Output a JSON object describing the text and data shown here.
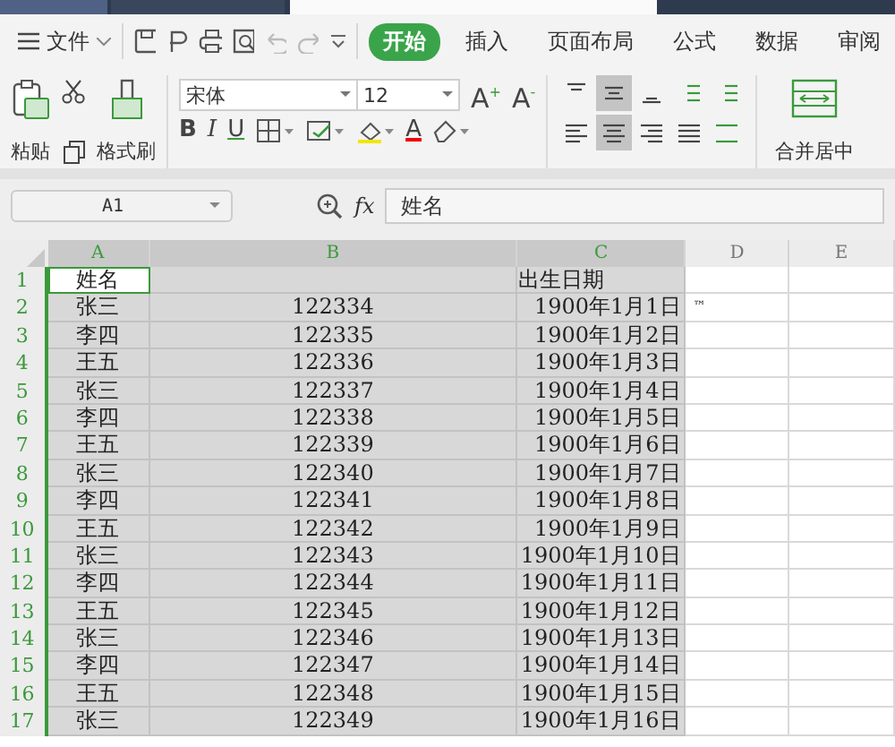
{
  "menu": {
    "file_label": "文件",
    "tabs": [
      {
        "label": "开始",
        "selected": true
      },
      {
        "label": "插入",
        "selected": false
      },
      {
        "label": "页面布局",
        "selected": false
      },
      {
        "label": "公式",
        "selected": false
      },
      {
        "label": "数据",
        "selected": false
      },
      {
        "label": "审阅",
        "selected": false
      }
    ]
  },
  "ribbon": {
    "paste_label": "粘贴",
    "painter_label": "格式刷",
    "font": "宋体",
    "size": "12",
    "grow_label": "A",
    "grow_mark": "+",
    "shrink_label": "A",
    "shrink_mark": "-",
    "style_buttons": [
      {
        "kind": "bold",
        "label": "B"
      },
      {
        "kind": "italic",
        "label": "I"
      },
      {
        "kind": "underline",
        "label": "U"
      }
    ],
    "font_color_label": "A",
    "align_top": [
      {
        "kind": "top",
        "selected": false
      },
      {
        "kind": "middle",
        "selected": true
      },
      {
        "kind": "bottom",
        "selected": false
      },
      {
        "kind": "outdent",
        "selected": false
      },
      {
        "kind": "indent",
        "selected": false
      }
    ],
    "align_bottom": [
      {
        "kind": "left",
        "selected": false
      },
      {
        "kind": "center",
        "selected": true
      },
      {
        "kind": "right",
        "selected": false
      },
      {
        "kind": "justify",
        "selected": false
      },
      {
        "kind": "distribute",
        "selected": false
      }
    ],
    "merge_label": "合并居中"
  },
  "formula_bar": {
    "name_box": "A1",
    "fx": "fx",
    "value": "姓名"
  },
  "columns": [
    {
      "label": "A",
      "selected": true
    },
    {
      "label": "B",
      "selected": true
    },
    {
      "label": "C",
      "selected": true
    },
    {
      "label": "D",
      "selected": false
    },
    {
      "label": "E",
      "selected": false
    }
  ],
  "rows": [
    {
      "num": "1",
      "name": "姓名",
      "date": "出生日期",
      "header": true,
      "active": true
    },
    {
      "num": "2",
      "name": "张三",
      "id": "122334",
      "date": "1900年1月1日",
      "d": "™",
      "header": false,
      "active": false
    },
    {
      "num": "3",
      "name": "李四",
      "id": "122335",
      "date": "1900年1月2日",
      "header": false,
      "active": false
    },
    {
      "num": "4",
      "name": "王五",
      "id": "122336",
      "date": "1900年1月3日",
      "header": false,
      "active": false
    },
    {
      "num": "5",
      "name": "张三",
      "id": "122337",
      "date": "1900年1月4日",
      "header": false,
      "active": false
    },
    {
      "num": "6",
      "name": "李四",
      "id": "122338",
      "date": "1900年1月5日",
      "header": false,
      "active": false
    },
    {
      "num": "7",
      "name": "王五",
      "id": "122339",
      "date": "1900年1月6日",
      "header": false,
      "active": false
    },
    {
      "num": "8",
      "name": "张三",
      "id": "122340",
      "date": "1900年1月7日",
      "header": false,
      "active": false
    },
    {
      "num": "9",
      "name": "李四",
      "id": "122341",
      "date": "1900年1月8日",
      "header": false,
      "active": false
    },
    {
      "num": "10",
      "name": "王五",
      "id": "122342",
      "date": "1900年1月9日",
      "header": false,
      "active": false
    },
    {
      "num": "11",
      "name": "张三",
      "id": "122343",
      "date": "1900年1月10日",
      "header": false,
      "active": false
    },
    {
      "num": "12",
      "name": "李四",
      "id": "122344",
      "date": "1900年1月11日",
      "header": false,
      "active": false
    },
    {
      "num": "13",
      "name": "王五",
      "id": "122345",
      "date": "1900年1月12日",
      "header": false,
      "active": false
    },
    {
      "num": "14",
      "name": "张三",
      "id": "122346",
      "date": "1900年1月13日",
      "header": false,
      "active": false
    },
    {
      "num": "15",
      "name": "李四",
      "id": "122347",
      "date": "1900年1月14日",
      "header": false,
      "active": false
    },
    {
      "num": "16",
      "name": "王五",
      "id": "122348",
      "date": "1900年1月15日",
      "header": false,
      "active": false
    },
    {
      "num": "17",
      "name": "张三",
      "id": "122349",
      "date": "1900年1月16日",
      "header": false,
      "active": false
    }
  ]
}
